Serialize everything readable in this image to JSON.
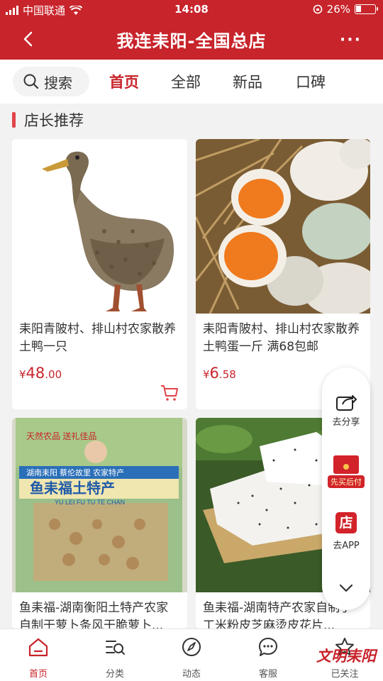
{
  "status": {
    "carrier": "中国联通",
    "time": "14:08",
    "battery": "26%",
    "battery_level": 0.26
  },
  "header": {
    "title": "我连耒阳-全国总店",
    "more": "···"
  },
  "tabs": {
    "search_label": "搜索",
    "items": [
      "首页",
      "全部",
      "新品",
      "口碑"
    ],
    "active_index": 0
  },
  "section": {
    "title": "店长推荐"
  },
  "products": [
    {
      "name": "耒阳青陂村、排山村农家散养土鸭一只",
      "currency": "¥",
      "price_int": "48",
      "price_dec": ".00"
    },
    {
      "name": "耒阳青陂村、排山村农家散养土鸭蛋一斤 满68包邮",
      "currency": "¥",
      "price_int": "6",
      "price_dec": ".58"
    },
    {
      "name": "鱼耒福-湖南衡阳土特产农家自制干萝卜条风干脆萝卜...",
      "package_brand": "鱼耒福土特产",
      "package_top": "天然农品 送礼佳品",
      "package_origin": "湖南耒阳 蔡伦故里 农家特产",
      "package_pinyin": "YU LEI FU TU TE CHAN"
    },
    {
      "name": "鱼耒福-湖南特产农家自制手工米粉皮芝麻烫皮花片..."
    }
  ],
  "float": {
    "share": "去分享",
    "buy_later": "先买后付",
    "shop_icon": "店",
    "app": "去APP"
  },
  "bottom_nav": {
    "items": [
      "首页",
      "分类",
      "动态",
      "客服",
      "已关注"
    ],
    "watermark": "文明耒阳",
    "active_index": 0
  },
  "colors": {
    "brand_red": "#c8242b",
    "accent": "#e2444b"
  }
}
